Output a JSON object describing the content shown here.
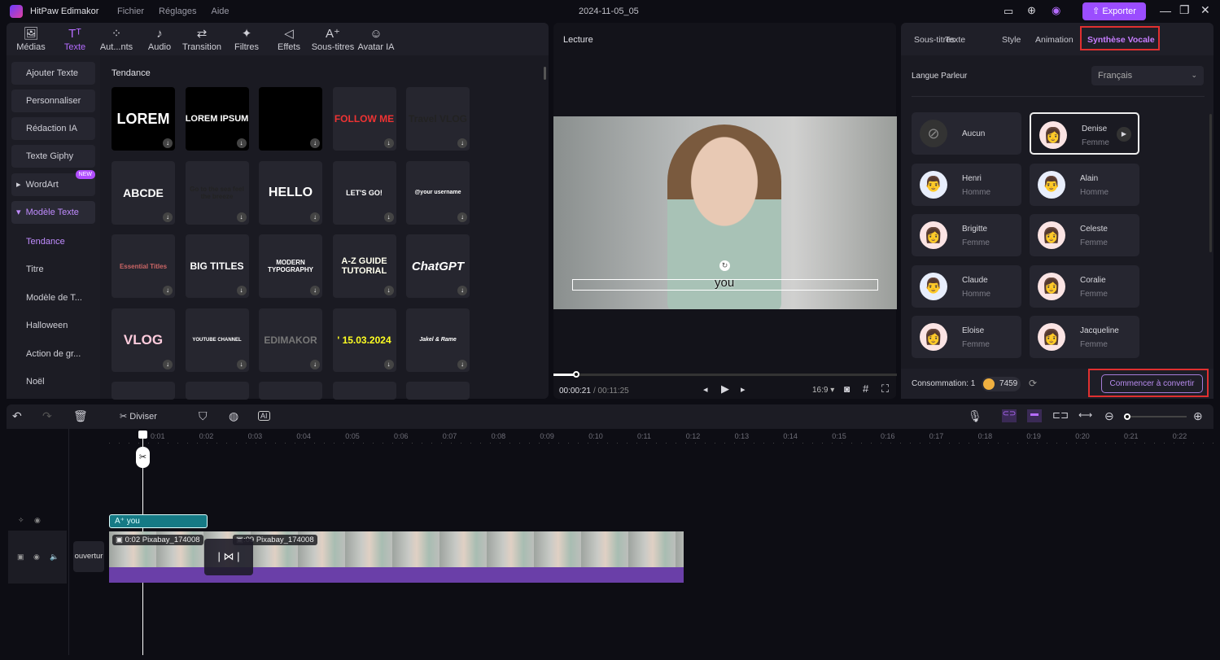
{
  "app": {
    "title": "HitPaw Edimakor",
    "menu": [
      "Fichier",
      "Réglages",
      "Aide"
    ],
    "project_name": "2024-11-05_05",
    "export_label": "Exporter",
    "accent": "#9b4dff"
  },
  "toolbar": [
    {
      "label": "Médias",
      "icon": "media-icon"
    },
    {
      "label": "Texte",
      "icon": "text-icon",
      "active": true
    },
    {
      "label": "Aut...nts",
      "icon": "elements-icon"
    },
    {
      "label": "Audio",
      "icon": "music-icon"
    },
    {
      "label": "Transition",
      "icon": "transition-icon"
    },
    {
      "label": "Filtres",
      "icon": "filter-icon"
    },
    {
      "label": "Effets",
      "icon": "effects-icon"
    },
    {
      "label": "Sous-titres",
      "icon": "subtitles-icon"
    },
    {
      "label": "Avatar IA",
      "icon": "avatar-icon"
    }
  ],
  "sidebar": {
    "buttons": [
      "Ajouter Texte",
      "Personnaliser",
      "Rédaction IA",
      "Texte Giphy"
    ],
    "wordart": "WordArt",
    "new_badge": "NEW",
    "modele": "Modèle Texte",
    "sub": [
      "Tendance",
      "Titre",
      "Modèle de T...",
      "Halloween",
      "Action de gr...",
      "Noël"
    ]
  },
  "gallery": {
    "heading": "Tendance",
    "items": [
      "LOREM",
      "LOREM IPSUM",
      "",
      "FOLLOW ME",
      "Travel VLOG",
      "ABCDE",
      "Go to the sea feel the breeze",
      "HELLO",
      "LET'S GO!",
      "@your username",
      "Essential Titles",
      "BIG TITLES",
      "MODERN TYPOGRAPHY",
      "A-Z GUIDE TUTORIAL",
      "ChatGPT",
      "VLOG",
      "YOUTUBE CHANNEL",
      "EDIMAKOR",
      "' 15.03.2024",
      "Jakel & Rame",
      "",
      "",
      "",
      "",
      ""
    ]
  },
  "preview": {
    "title": "Lecture",
    "caption": "you",
    "current_time": "00:00:21",
    "total_time": "/ 00:11:25",
    "aspect": "16:9",
    "progress_percent": 7
  },
  "right": {
    "tabs": [
      "Sous-titres",
      "Texte",
      "Style",
      "Animation",
      "Synthèse Vocale"
    ],
    "active_tab": "Synthèse Vocale",
    "lang_label": "Langue Parleur",
    "lang_value": "Français",
    "voices": [
      {
        "name": "Aucun",
        "gender": ""
      },
      {
        "name": "Denise",
        "gender": "Femme",
        "selected": true
      },
      {
        "name": "Henri",
        "gender": "Homme"
      },
      {
        "name": "Alain",
        "gender": "Homme"
      },
      {
        "name": "Brigitte",
        "gender": "Femme"
      },
      {
        "name": "Celeste",
        "gender": "Femme"
      },
      {
        "name": "Claude",
        "gender": "Homme"
      },
      {
        "name": "Coralie",
        "gender": "Femme"
      },
      {
        "name": "Eloise",
        "gender": "Femme"
      },
      {
        "name": "Jacqueline",
        "gender": "Femme"
      }
    ],
    "consumption": "Consommation: 1",
    "credits": "7459",
    "convert_label": "Commencer à convertir"
  },
  "timeline": {
    "split_label": "Diviser",
    "ticks": [
      "0:01",
      "0:02",
      "0:03",
      "0:04",
      "0:05",
      "0:06",
      "0:07",
      "0:08",
      "0:09",
      "0:10",
      "0:11",
      "0:12",
      "0:13",
      "0:14",
      "0:15",
      "0:16",
      "0:17",
      "0:18",
      "0:19",
      "0:20",
      "0:21",
      "0:22"
    ],
    "text_clip": "you",
    "clip1": "0:02 Pixabay_174008",
    "clip2": ":09 Pixabay_174008",
    "cover_label": "ouvertur"
  }
}
